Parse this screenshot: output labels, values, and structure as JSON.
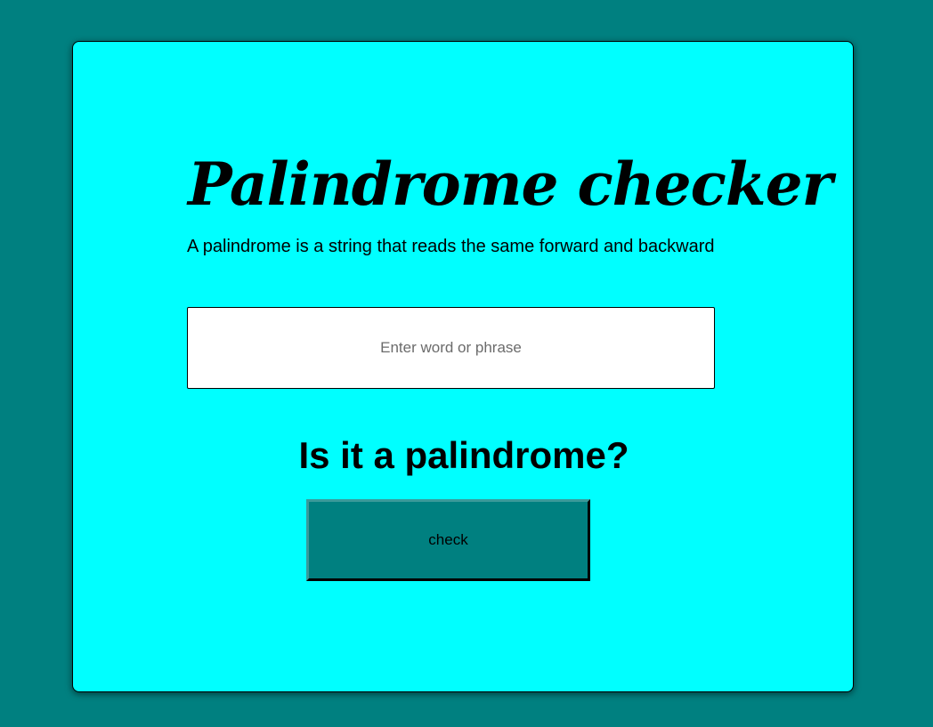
{
  "app": {
    "title": "Palindrome checker",
    "subtitle": "A palindrome is a string that reads the same forward and backward"
  },
  "input": {
    "placeholder": "Enter word or phrase",
    "value": ""
  },
  "result": {
    "heading": "Is it a palindrome?"
  },
  "actions": {
    "check_label": "check"
  },
  "colors": {
    "background": "#008080",
    "card": "#00ffff",
    "button": "#008080"
  }
}
